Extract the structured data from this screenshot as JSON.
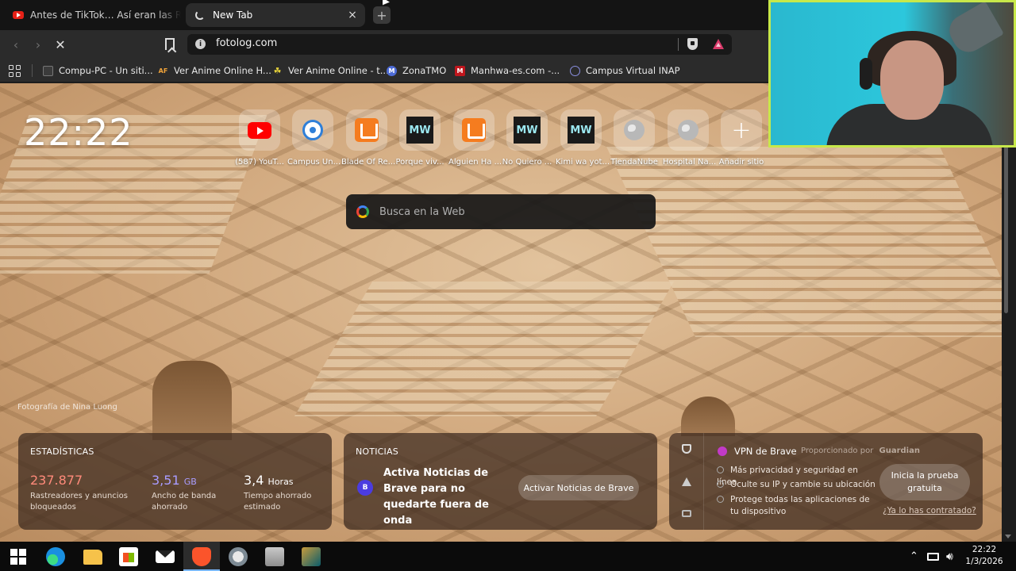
{
  "tabs": [
    {
      "title": "Antes de TikTok… Así eran las Redes S",
      "active": false,
      "favicon": "youtube-icon"
    },
    {
      "title": "New Tab",
      "active": true,
      "favicon": "loading-spinner"
    }
  ],
  "toolbar": {
    "url": "fotolog.com",
    "new_tab_label": "+",
    "close_tab_label": "×"
  },
  "bookmarks": [
    {
      "label": "Compu-PC - Un siti...",
      "icon": "compu-pc-icon"
    },
    {
      "label": "Ver Anime Online H...",
      "icon": "af-icon"
    },
    {
      "label": "Ver Anime Online - t...",
      "icon": "leaf-icon"
    },
    {
      "label": "ZonaTMO",
      "icon": "zonatmo-icon"
    },
    {
      "label": "Manhwa-es.com -...",
      "icon": "manhwa-icon"
    },
    {
      "label": "Campus Virtual INAP",
      "icon": "campus-icon"
    }
  ],
  "newtab": {
    "clock": "22:22",
    "photo_credit": "Fotografía de Nina Luong",
    "search_placeholder": "Busca en la Web",
    "top_sites": [
      {
        "label": "(587) YouT...",
        "icon": "youtube-icon"
      },
      {
        "label": "Campus Un...",
        "icon": "campus-icon"
      },
      {
        "label": "Blade Of Re...",
        "icon": "book-icon"
      },
      {
        "label": "Porque viv...",
        "icon": "mw-icon",
        "tile_text": "MW"
      },
      {
        "label": "Alguien Ha ...",
        "icon": "book-icon"
      },
      {
        "label": "No Quiero ...",
        "icon": "mw-icon",
        "tile_text": "MW"
      },
      {
        "label": "Kimi wa yot...",
        "icon": "mw-icon",
        "tile_text": "MW"
      },
      {
        "label": "TiendaNube",
        "icon": "globe-icon"
      },
      {
        "label": "Hospital Na...",
        "icon": "globe-icon"
      },
      {
        "label": "Añadir sitio",
        "icon": "plus-icon",
        "tile_text": "+"
      }
    ]
  },
  "stats": {
    "title": "ESTADÍSTICAS",
    "items": [
      {
        "value": "237.877",
        "unit": "",
        "desc": "Rastreadores y anuncios bloqueados",
        "color": "#ff8a7a"
      },
      {
        "value": "3,51",
        "unit": "GB",
        "desc": "Ancho de banda ahorrado",
        "color": "#a99cff"
      },
      {
        "value": "3,4",
        "unit": "Horas",
        "desc": "Tiempo ahorrado estimado",
        "color": "#ffffff"
      }
    ]
  },
  "news": {
    "title": "NOTICIAS",
    "avatar": "B",
    "text": "Activa Noticias de Brave para no quedarte fuera de onda",
    "button": "Activar Noticias de Brave"
  },
  "vpn": {
    "title": "VPN de Brave",
    "powered_by": "Proporcionado por",
    "powered_brand": "Guardian",
    "features": [
      "Más privacidad y seguridad en línea",
      "Oculte su IP y cambie su ubicación",
      "Protege todas las aplicaciones de tu dispositivo"
    ],
    "trial_button": "Inicia la prueba gratuita",
    "already_link": "¿Ya lo has contratado?"
  },
  "taskbar": {
    "time": "22:22",
    "date": "1/3/2026"
  }
}
